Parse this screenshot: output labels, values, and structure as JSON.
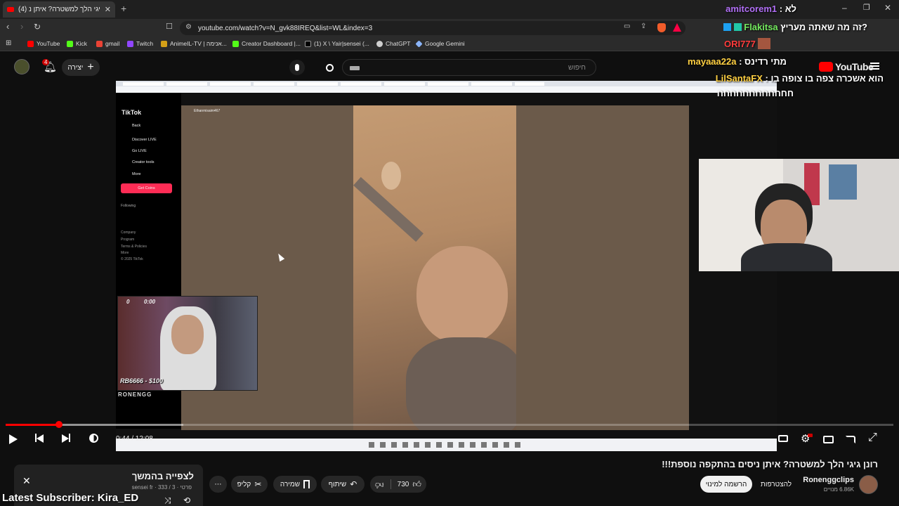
{
  "browser": {
    "tab_title": "(4) רונן גיגי הלך למשטרה? איתן נ",
    "url": "youtube.com/watch?v=N_gvk88IREQ&list=WL&index=3",
    "bookmarks": [
      {
        "label": "YouTube",
        "color": "#ff0000"
      },
      {
        "label": "Kick",
        "color": "#53fc18"
      },
      {
        "label": "gmail",
        "color": "#ea4335"
      },
      {
        "label": "Twitch",
        "color": "#9146ff"
      },
      {
        "label": "AnimeIL-TV | אנימה...",
        "color": "#d4a017"
      },
      {
        "label": "Creator Dashboard |...",
        "color": "#53fc18"
      },
      {
        "label": "(1) X \\ Yair|sensei (...",
        "color": "#ffffff"
      },
      {
        "label": "ChatGPT",
        "color": "#cfcfcf"
      },
      {
        "label": "Google Gemini",
        "color": "#8ab4f8"
      }
    ]
  },
  "youtube": {
    "notif_count": "4",
    "create_label": "יצירה",
    "search_placeholder": "חיפוש",
    "logo_text": "YouTube"
  },
  "tiktok": {
    "logo": "TikTok",
    "nav": [
      "Back",
      "Discover LIVE",
      "Go LIVE",
      "Creator tools",
      "More"
    ],
    "get_coins": "Get Coins",
    "following": "Following",
    "footer": [
      "Company",
      "Program",
      "Terms & Policies",
      "More",
      "© 2025 TikTok"
    ],
    "username": "Ethanmisaim467"
  },
  "overlay": {
    "cam_time": "0:00",
    "cam_count": "0",
    "donation": "RB6666 - $100",
    "channel_tag": "RONENGG"
  },
  "player": {
    "time": "0:44 / 12:08",
    "progress": 0.06,
    "buffered": 0.2
  },
  "chat": [
    {
      "user": "amitcorem1",
      "user_color": "#b16ff6",
      "msg": "לא :"
    },
    {
      "user": "Flakitsa",
      "user_color": "#73e85e",
      "msg": "זה מה שאתה מעריץ?"
    },
    {
      "user": "ORI777",
      "user_color": "#ff3b3b",
      "msg": ""
    },
    {
      "user": "mayaaa22a",
      "user_color": "#ffd042",
      "msg": "מתי רדינס :"
    },
    {
      "user": "LilSantaFX",
      "user_color": "#ffd042",
      "msg": "הוא אשכרה צפה בו צופה בו :"
    },
    {
      "user": "",
      "user_color": "#ffffff",
      "msg": "חחחחחחחחחחחח"
    }
  ],
  "below": {
    "video_title": "רונן גיגי הלך למשטרה? איתן ניסים בהתקפה נוספת!!!",
    "channel_name": "Ronenggclips",
    "subscribers": "6.86K מנויים",
    "join": "להצטרפות",
    "subscribe": "הרשמה למינוי",
    "likes": "730",
    "share": "שיתוף",
    "save": "שמירה",
    "clip": "קליפ",
    "playlist_title": "לצפייה בהמשך",
    "playlist_meta": "sensei fr · פרטי · 3 / 333",
    "latest_subscriber": "Latest Subscriber: Kira_ED"
  }
}
